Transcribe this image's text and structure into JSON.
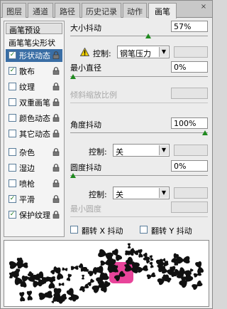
{
  "tabs": [
    {
      "label": "图层",
      "active": false
    },
    {
      "label": "通道",
      "active": false
    },
    {
      "label": "路径",
      "active": false
    },
    {
      "label": "历史记录",
      "active": false
    },
    {
      "label": "动作",
      "active": false
    },
    {
      "label": "画笔",
      "active": true
    }
  ],
  "tab_close": "×",
  "sidebar": {
    "preset_button": "画笔预设",
    "tip_shape_label": "画笔笔尖形状",
    "items": [
      {
        "label": "形状动态",
        "checked": true,
        "selected": true,
        "locked": true
      },
      {
        "label": "散布",
        "checked": true,
        "selected": false,
        "locked": true
      },
      {
        "label": "纹理",
        "checked": false,
        "selected": false,
        "locked": true
      },
      {
        "label": "双重画笔",
        "checked": false,
        "selected": false,
        "locked": true
      },
      {
        "label": "颜色动态",
        "checked": false,
        "selected": false,
        "locked": true
      },
      {
        "label": "其它动态",
        "checked": false,
        "selected": false,
        "locked": true
      },
      {
        "label": "杂色",
        "checked": false,
        "selected": false,
        "locked": true
      },
      {
        "label": "湿边",
        "checked": false,
        "selected": false,
        "locked": true
      },
      {
        "label": "喷枪",
        "checked": false,
        "selected": false,
        "locked": true
      },
      {
        "label": "平滑",
        "checked": true,
        "selected": false,
        "locked": true
      },
      {
        "label": "保护纹理",
        "checked": true,
        "selected": false,
        "locked": true
      }
    ]
  },
  "shape_dynamics": {
    "size_jitter": {
      "label": "大小抖动",
      "value": "57%",
      "level": 0.57
    },
    "size_control": {
      "label": "控制:",
      "value": "钢笔压力"
    },
    "min_diameter": {
      "label": "最小直径",
      "value": "0%",
      "level": 0.0
    },
    "tilt_scale": {
      "label": "倾斜缩放比例",
      "value": ""
    },
    "angle_jitter": {
      "label": "角度抖动",
      "value": "100%",
      "level": 1.0
    },
    "angle_control": {
      "label": "控制:",
      "value": "关"
    },
    "roundness_jitter": {
      "label": "圆度抖动",
      "value": "0%",
      "level": 0.0
    },
    "roundness_control": {
      "label": "控制:",
      "value": "关"
    },
    "min_roundness": {
      "label": "最小圆度",
      "value": ""
    },
    "flip_x": {
      "label": "翻转 X 抖动",
      "checked": false
    },
    "flip_y": {
      "label": "翻转 Y 抖动",
      "checked": false
    }
  },
  "colors": {
    "selected_bg": "#3a6ea5",
    "check_green": "#1d7a1d",
    "slider_thumb": "#1f8a1f",
    "preview_mark": "#e8449a"
  }
}
